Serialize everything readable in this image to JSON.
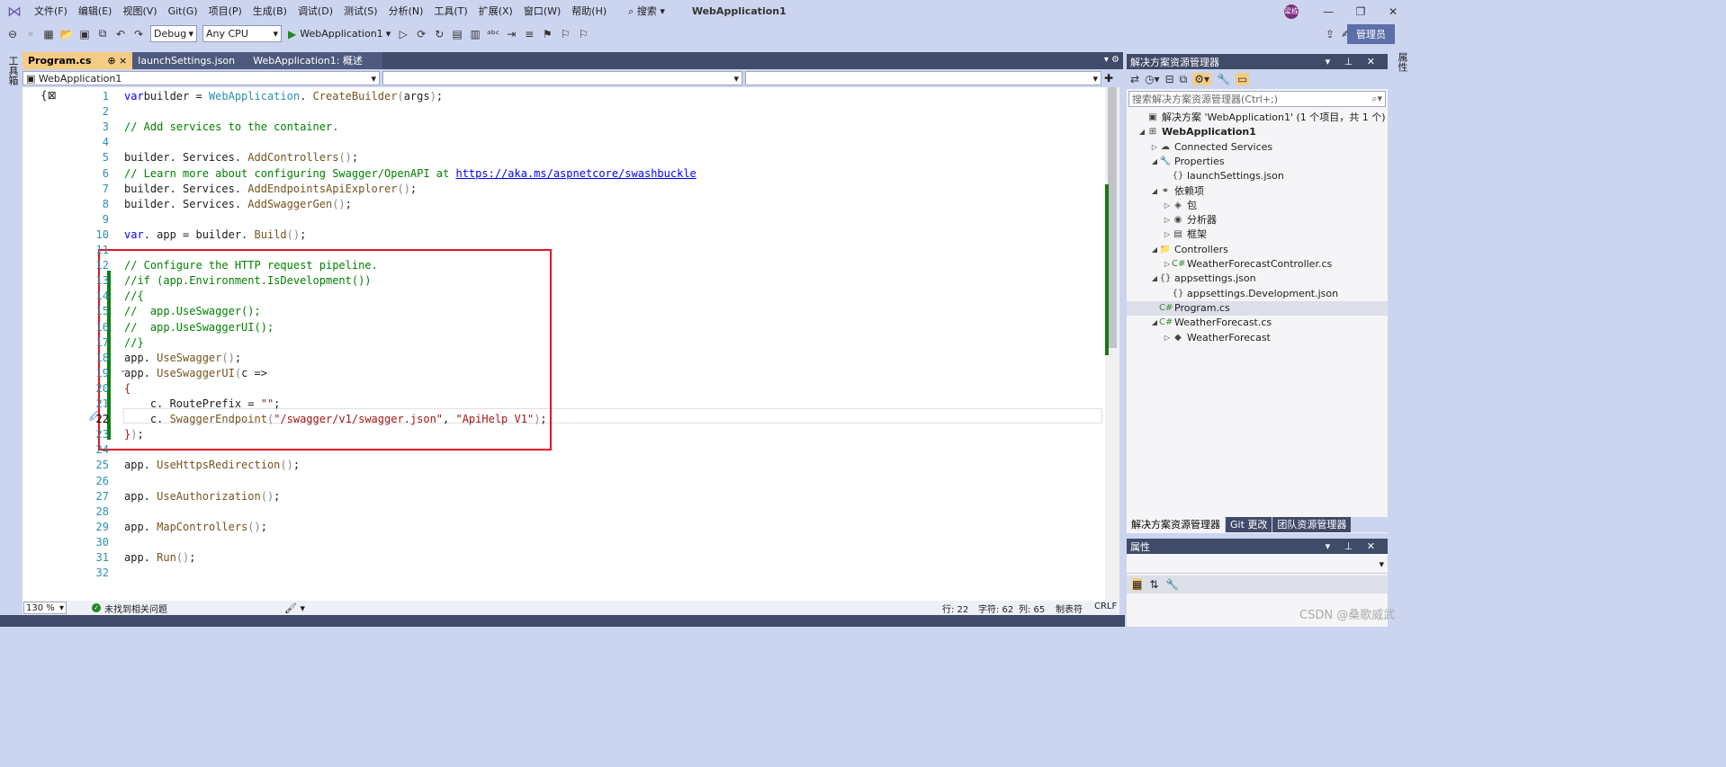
{
  "menubar": {
    "items": [
      "文件(F)",
      "编辑(E)",
      "视图(V)",
      "Git(G)",
      "项目(P)",
      "生成(B)",
      "调试(D)",
      "测试(S)",
      "分析(N)",
      "工具(T)",
      "扩展(X)",
      "窗口(W)",
      "帮助(H)"
    ],
    "search_label": "搜索",
    "window_title": "WebApplication1",
    "avatar_text": "梁栋"
  },
  "toolbar": {
    "config": "Debug",
    "platform": "Any CPU",
    "run_target": "WebApplication1",
    "admin_label": "管理员"
  },
  "left_tab_label": "工具箱",
  "right_tab_label": "属性",
  "doc_tabs": [
    {
      "label": "Program.cs",
      "extra": "⊕ ×"
    },
    {
      "label": "launchSettings.json",
      "extra": ""
    },
    {
      "label": "WebApplication1: 概述",
      "extra": ""
    }
  ],
  "nav": {
    "project": "WebApplication1",
    "member": "",
    "scope": ""
  },
  "code_lines": [
    {
      "n": "1",
      "parts": [
        [
          "kw",
          "var"
        ],
        [
          "",
          "builder = "
        ],
        [
          "ty",
          "WebApplication"
        ],
        [
          "",
          ". "
        ],
        [
          "fn",
          "CreateBuilder"
        ],
        [
          "pn",
          "("
        ],
        [
          "",
          "args"
        ],
        [
          "pn",
          ")"
        ],
        [
          "",
          ";"
        ]
      ]
    },
    {
      "n": "2",
      "parts": []
    },
    {
      "n": "3",
      "parts": [
        [
          "cm",
          "// Add services to the container."
        ]
      ]
    },
    {
      "n": "4",
      "parts": []
    },
    {
      "n": "5",
      "parts": [
        [
          "",
          "builder. Services. "
        ],
        [
          "fn",
          "AddControllers"
        ],
        [
          "pn",
          "()"
        ],
        [
          "",
          ";"
        ]
      ]
    },
    {
      "n": "6",
      "parts": [
        [
          "cm",
          "// Learn more about configuring Swagger/OpenAPI at "
        ],
        [
          "lnk",
          "https://aka.ms/aspnetcore/swashbuckle"
        ]
      ]
    },
    {
      "n": "7",
      "parts": [
        [
          "",
          "builder. Services. "
        ],
        [
          "fn",
          "AddEndpointsApiExplorer"
        ],
        [
          "pn",
          "()"
        ],
        [
          "",
          ";"
        ]
      ]
    },
    {
      "n": "8",
      "parts": [
        [
          "",
          "builder. Services. "
        ],
        [
          "fn",
          "AddSwaggerGen"
        ],
        [
          "pn",
          "()"
        ],
        [
          "",
          ";"
        ]
      ]
    },
    {
      "n": "9",
      "parts": []
    },
    {
      "n": "10",
      "parts": [
        [
          "kw",
          "var"
        ],
        [
          "",
          ". app = builder. "
        ],
        [
          "fn",
          "Build"
        ],
        [
          "pn",
          "()"
        ],
        [
          "",
          ";"
        ]
      ]
    },
    {
      "n": "11",
      "parts": []
    },
    {
      "n": "12",
      "parts": [
        [
          "cm",
          "// Configure the HTTP request pipeline."
        ]
      ]
    },
    {
      "n": "13",
      "parts": [
        [
          "cm",
          "//if (app.Environment.IsDevelopment())"
        ]
      ]
    },
    {
      "n": "14",
      "parts": [
        [
          "cm",
          "//{"
        ]
      ]
    },
    {
      "n": "15",
      "parts": [
        [
          "cm",
          "//  app.UseSwagger();"
        ]
      ]
    },
    {
      "n": "16",
      "parts": [
        [
          "cm",
          "//  app.UseSwaggerUI();"
        ]
      ]
    },
    {
      "n": "17",
      "parts": [
        [
          "cm",
          "//}"
        ]
      ]
    },
    {
      "n": "18",
      "parts": [
        [
          "",
          "app. "
        ],
        [
          "fn",
          "UseSwagger"
        ],
        [
          "pn",
          "()"
        ],
        [
          "",
          ";"
        ]
      ]
    },
    {
      "n": "19",
      "parts": [
        [
          "",
          "app. "
        ],
        [
          "fn",
          "UseSwaggerUI"
        ],
        [
          "pn",
          "("
        ],
        [
          "",
          "c =>"
        ]
      ]
    },
    {
      "n": "20",
      "parts": [
        [
          "st",
          "{"
        ]
      ]
    },
    {
      "n": "21",
      "parts": [
        [
          "",
          "    c. RoutePrefix = "
        ],
        [
          "st",
          "\"\""
        ],
        [
          "",
          ";"
        ]
      ]
    },
    {
      "n": "22",
      "parts": [
        [
          "",
          "    c. "
        ],
        [
          "fn",
          "SwaggerEndpoint"
        ],
        [
          "pn",
          "("
        ],
        [
          "st",
          "\"/swagger/v1/swagger.json\""
        ],
        [
          "",
          ", "
        ],
        [
          "st",
          "\"ApiHelp V1\""
        ],
        [
          "pn",
          ")"
        ],
        [
          "",
          ";"
        ]
      ]
    },
    {
      "n": "23",
      "parts": [
        [
          "st",
          "}"
        ],
        [
          "pn",
          ")"
        ],
        [
          "",
          ";"
        ]
      ]
    },
    {
      "n": "24",
      "parts": []
    },
    {
      "n": "25",
      "parts": [
        [
          "",
          "app. "
        ],
        [
          "fn",
          "UseHttpsRedirection"
        ],
        [
          "pn",
          "()"
        ],
        [
          "",
          ";"
        ]
      ]
    },
    {
      "n": "26",
      "parts": []
    },
    {
      "n": "27",
      "parts": [
        [
          "",
          "app. "
        ],
        [
          "fn",
          "UseAuthorization"
        ],
        [
          "pn",
          "()"
        ],
        [
          "",
          ";"
        ]
      ]
    },
    {
      "n": "28",
      "parts": []
    },
    {
      "n": "29",
      "parts": [
        [
          "",
          "app. "
        ],
        [
          "fn",
          "MapControllers"
        ],
        [
          "pn",
          "()"
        ],
        [
          "",
          ";"
        ]
      ]
    },
    {
      "n": "30",
      "parts": []
    },
    {
      "n": "31",
      "parts": [
        [
          "",
          "app. "
        ],
        [
          "fn",
          "Run"
        ],
        [
          "pn",
          "()"
        ],
        [
          "",
          ";"
        ]
      ]
    },
    {
      "n": "32",
      "parts": []
    }
  ],
  "status": {
    "zoom": "130 %",
    "issues": "未找到相关问题",
    "line": "行: 22",
    "char": "字符: 62",
    "col": "列: 65",
    "indent": "制表符",
    "eol": "CRLF"
  },
  "solution_explorer": {
    "title": "解决方案资源管理器",
    "search_placeholder": "搜索解决方案资源管理器(Ctrl+;)",
    "items": [
      {
        "label": "解决方案 'WebApplication1' (1 个项目，共 1 个)",
        "icon": "solution-icon",
        "glyph": "▣",
        "bold": false
      },
      {
        "label": "WebApplication1",
        "icon": "project-icon",
        "glyph": "⊞",
        "bold": true
      },
      {
        "label": "Connected Services",
        "icon": "connected-services-icon",
        "glyph": "☁",
        "bold": false
      },
      {
        "label": "Properties",
        "icon": "properties-icon",
        "glyph": "🔧",
        "bold": false
      },
      {
        "label": "launchSettings.json",
        "icon": "json-file-icon",
        "glyph": "{}",
        "bold": false
      },
      {
        "label": "依赖项",
        "icon": "dependencies-icon",
        "glyph": "⚭",
        "bold": false
      },
      {
        "label": "包",
        "icon": "package-icon",
        "glyph": "◈",
        "bold": false
      },
      {
        "label": "分析器",
        "icon": "analyzer-icon",
        "glyph": "◉",
        "bold": false
      },
      {
        "label": "框架",
        "icon": "framework-icon",
        "glyph": "▤",
        "bold": false
      },
      {
        "label": "Controllers",
        "icon": "folder-icon",
        "glyph": "📁",
        "bold": false
      },
      {
        "label": "WeatherForecastController.cs",
        "icon": "csharp-file-icon",
        "glyph": "C#",
        "bold": false
      },
      {
        "label": "appsettings.json",
        "icon": "json-file-icon",
        "glyph": "{}",
        "bold": false
      },
      {
        "label": "appsettings.Development.json",
        "icon": "json-file-icon",
        "glyph": "{}",
        "bold": false
      },
      {
        "label": "Program.cs",
        "icon": "csharp-file-icon",
        "glyph": "C#",
        "bold": false
      },
      {
        "label": "WeatherForecast.cs",
        "icon": "csharp-file-icon",
        "glyph": "C#",
        "bold": false
      },
      {
        "label": "WeatherForecast",
        "icon": "class-icon",
        "glyph": "◆",
        "bold": false
      }
    ],
    "tabs": [
      "解决方案资源管理器",
      "Git 更改",
      "团队资源管理器"
    ]
  },
  "properties_panel": {
    "title": "属性"
  },
  "watermark": "CSDN @桑歌威武"
}
